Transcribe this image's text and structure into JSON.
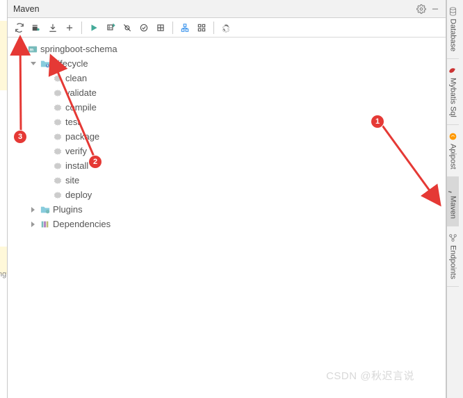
{
  "panel": {
    "title": "Maven"
  },
  "toolbar": {
    "reload": "Reload",
    "generate": "Generate",
    "download": "Download",
    "add": "Add",
    "run": "Run",
    "execute": "Execute",
    "skip_tests": "Skip Tests",
    "block": "Block",
    "offline": "Offline",
    "show_deps": "Dependencies",
    "show_graph": "Graph",
    "collapse": "Collapse",
    "settings": "Settings"
  },
  "tree": {
    "root": {
      "label": "springboot-schema",
      "expanded": true,
      "children": [
        {
          "label": "Lifecycle",
          "expanded": true,
          "items": [
            "clean",
            "validate",
            "compile",
            "test",
            "package",
            "verify",
            "install",
            "site",
            "deploy"
          ]
        },
        {
          "label": "Plugins",
          "expanded": false
        },
        {
          "label": "Dependencies",
          "expanded": false
        }
      ]
    }
  },
  "right_tabs": [
    {
      "label": "Database",
      "icon": "database",
      "active": false
    },
    {
      "label": "Mybatis Sql",
      "icon": "mybatis",
      "active": false
    },
    {
      "label": "Apipost",
      "icon": "apipost",
      "active": false
    },
    {
      "label": "Maven",
      "icon": "maven",
      "active": true
    },
    {
      "label": "Endpoints",
      "icon": "endpoints",
      "active": false
    }
  ],
  "annotations": {
    "badge1": "1",
    "badge2": "2",
    "badge3": "3"
  },
  "watermark": "CSDN @秋迟言说",
  "left_gutter_text": "ng"
}
